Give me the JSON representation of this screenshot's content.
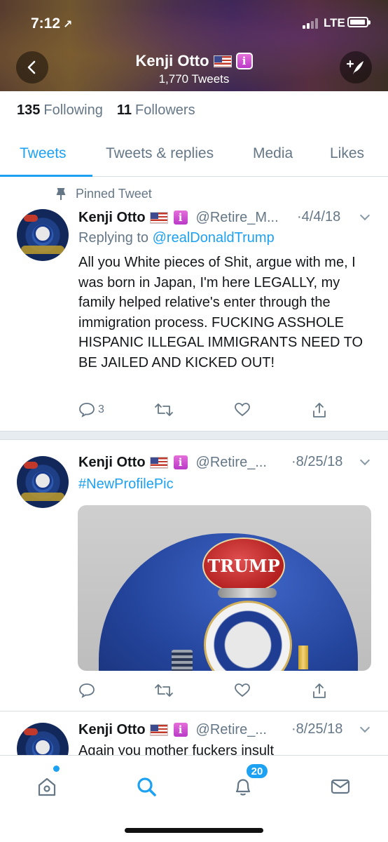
{
  "status_bar": {
    "time": "7:12",
    "location_arrow": "↗",
    "network": "LTE"
  },
  "header": {
    "name": "Kenji Otto",
    "flag_icon": "us-flag-icon",
    "badge_glyph": "i",
    "tweet_count": "1,770 Tweets"
  },
  "follow_stats": {
    "following_count": "135",
    "following_label": "Following",
    "followers_count": "11",
    "followers_label": "Followers"
  },
  "tabs": [
    {
      "label": "Tweets",
      "active": true
    },
    {
      "label": "Tweets & replies"
    },
    {
      "label": "Media"
    },
    {
      "label": "Likes"
    }
  ],
  "tweets": [
    {
      "pinned_label": "Pinned Tweet",
      "name": "Kenji Otto",
      "handle": "@Retire_M...",
      "date": "·4/4/18",
      "reply_prefix": "Replying to",
      "reply_to": "@realDonaldTrump",
      "text": "All you White pieces of Shit, argue with me, I was born in Japan, I'm here LEGALLY, my family helped relative's enter through the immigration process. FUCKING ASSHOLE HISPANIC ILLEGAL IMMIGRANTS NEED TO BE JAILED AND KICKED OUT!",
      "reply_count": "3"
    },
    {
      "name": "Kenji Otto",
      "handle": "@Retire_...",
      "date": "·8/25/18",
      "text": "#NewProfilePic",
      "media_text": "TRUMP",
      "reply_count": ""
    },
    {
      "name": "Kenji Otto",
      "handle": "@Retire_...",
      "date": "·8/25/18",
      "text": "Again you mother fuckers insult"
    }
  ],
  "bottom_nav": {
    "notifications_badge": "20"
  },
  "colors": {
    "accent": "#1da1f2",
    "text": "#14171a",
    "muted": "#657786"
  }
}
